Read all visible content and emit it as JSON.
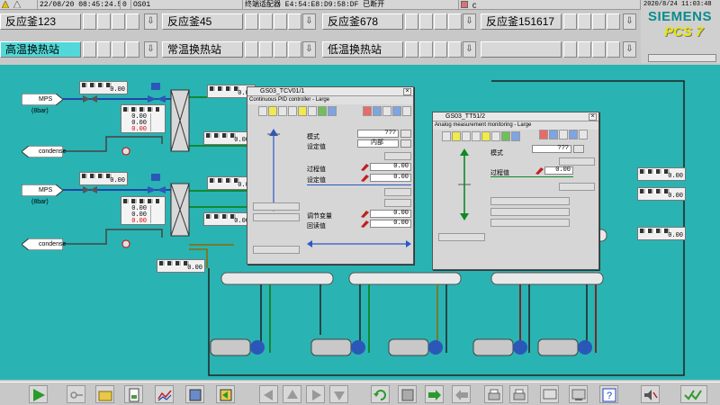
{
  "status_bar": {
    "datetime": "22/08/20 08:45:24.573",
    "sequence": "0",
    "station": "OS01",
    "message": "终端适配器 E4:54:E8:D9:58:DF 已断开",
    "indicator": "C"
  },
  "branding": {
    "datetime": "2020/8/24 11:03:48",
    "company": "SIEMENS",
    "product": "PCS 7"
  },
  "area_groups_row1": [
    {
      "label": "反应釜123"
    },
    {
      "label": "反应釜45"
    },
    {
      "label": "反应釜678"
    },
    {
      "label": "反应釜151617"
    }
  ],
  "area_groups_row2": [
    {
      "label": "高温换热站",
      "active": true
    },
    {
      "label": "常温换热站",
      "active": false
    },
    {
      "label": "低温换热站",
      "active": false
    }
  ],
  "process": {
    "inlet_top": "MPS (8bar)",
    "condense_top": "condense",
    "inlet_bottom": "MPS (8bar)",
    "condense_bottom": "condense",
    "valve_readout_top": {
      "v1": "0.00",
      "v2": "0.00",
      "v3": "0.00"
    },
    "valve_readout_bottom": {
      "v1": "0.00",
      "v2": "0.00",
      "v3": "0.00"
    },
    "tag_value": "0.00"
  },
  "faceplate_pid": {
    "title": "GS03_TCV01/1",
    "subtitle": "Continuous PID controller - Large",
    "mode_label": "模式",
    "mode_value": "???",
    "setpoint_label": "设定值",
    "setpoint_source": "内部",
    "pv_label": "过程值",
    "pv_value": "0.00",
    "sp_label": "设定值",
    "sp_value": "0.00",
    "mv_label": "调节变量",
    "mv_value": "0.00",
    "readback_label": "回读值",
    "readback_value": "0.00"
  },
  "faceplate_ai": {
    "title": "GS03_TT51/2",
    "subtitle": "Analog measurement monitoring - Large",
    "mode_label": "模式",
    "mode_value": "???",
    "pv_label": "过程值",
    "pv_value": "0.00"
  },
  "toolbar": {
    "buttons": [
      "start",
      "key",
      "folder",
      "report",
      "trend",
      "archive",
      "import",
      "nav-left",
      "nav-up",
      "nav-right",
      "nav-down",
      "refresh",
      "reload",
      "forward-area",
      "back-area",
      "print-a",
      "print-b",
      "screen",
      "help",
      "audio",
      "acknowledge"
    ]
  },
  "colors": {
    "process_background": "#2ab3b3",
    "active_group": "#52d8d8",
    "brand_teal": "#0a8c8c",
    "brand_yellow": "#e8e800",
    "alarm_red": "#e00000"
  }
}
